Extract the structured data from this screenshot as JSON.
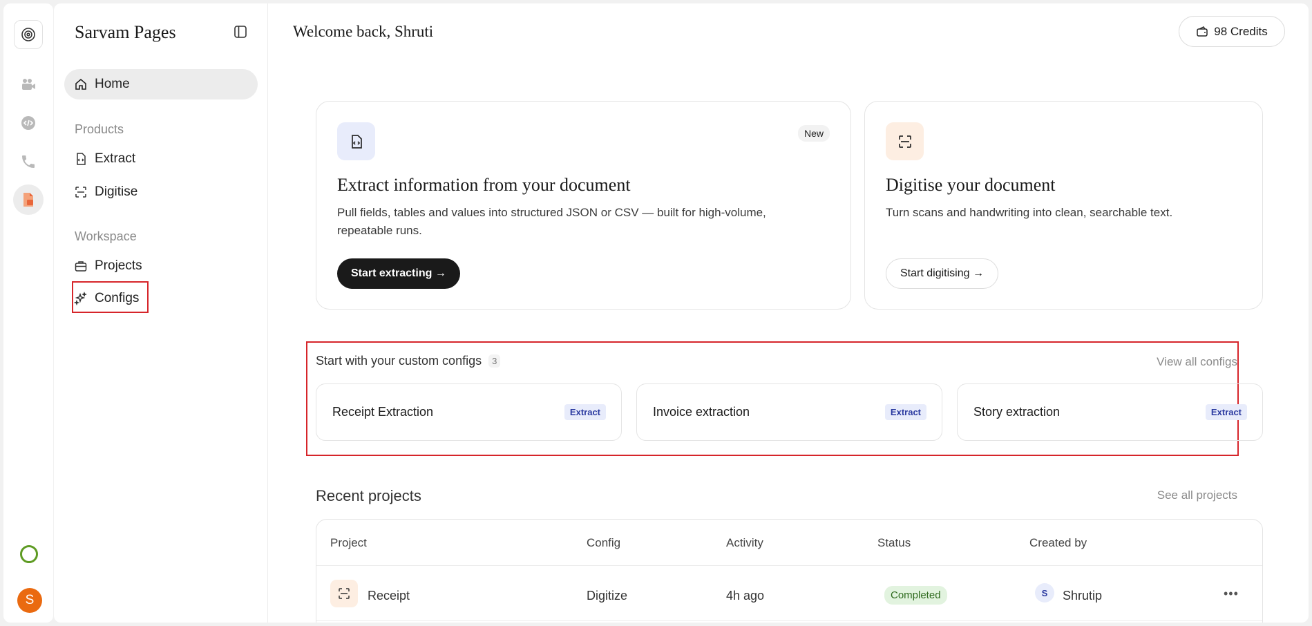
{
  "sidebar": {
    "title": "Sarvam Pages",
    "home_label": "Home",
    "products_label": "Products",
    "workspace_label": "Workspace",
    "items": {
      "extract": "Extract",
      "digitise": "Digitise",
      "projects": "Projects",
      "configs": "Configs"
    }
  },
  "rail": {
    "avatar_initial": "S",
    "icons": [
      "sarvam-logo-icon",
      "video-camera-icon",
      "code-icon",
      "phone-icon",
      "document-pages-icon",
      "status-ring-icon"
    ]
  },
  "header": {
    "welcome": "Welcome back, Shruti",
    "credits": "98 Credits"
  },
  "cards": {
    "extract": {
      "badge": "New",
      "title": "Extract information from your document",
      "description": "Pull fields, tables and values into structured JSON or CSV — built for high-volume, repeatable runs.",
      "button": "Start extracting →"
    },
    "digitise": {
      "title": "Digitise your document",
      "description": "Turn scans and handwriting into clean, searchable text.",
      "button": "Start digitising →"
    }
  },
  "custom_configs": {
    "heading": "Start with your custom configs",
    "count": "3",
    "view_all": "View all configs",
    "items": [
      {
        "name": "Receipt Extraction",
        "tag": "Extract"
      },
      {
        "name": "Invoice extraction",
        "tag": "Extract"
      },
      {
        "name": "Story extraction",
        "tag": "Extract"
      }
    ]
  },
  "recent_projects": {
    "title": "Recent projects",
    "see_all": "See all projects",
    "columns": [
      "Project",
      "Config",
      "Activity",
      "Status",
      "Created by"
    ],
    "rows": [
      {
        "project": "Receipt",
        "config": "Digitize",
        "activity": "4h ago",
        "status": "Completed",
        "created_initial": "S",
        "created_by": "Shrutip"
      }
    ]
  },
  "colors": {
    "accent_dark": "#1a1a1a",
    "highlight_outline": "#d6252a",
    "avatar": "#ea6a10",
    "status_ring": "#5e9b23",
    "extract_tag_bg": "#e8ecfb",
    "completed_bg": "#e2f3df"
  }
}
